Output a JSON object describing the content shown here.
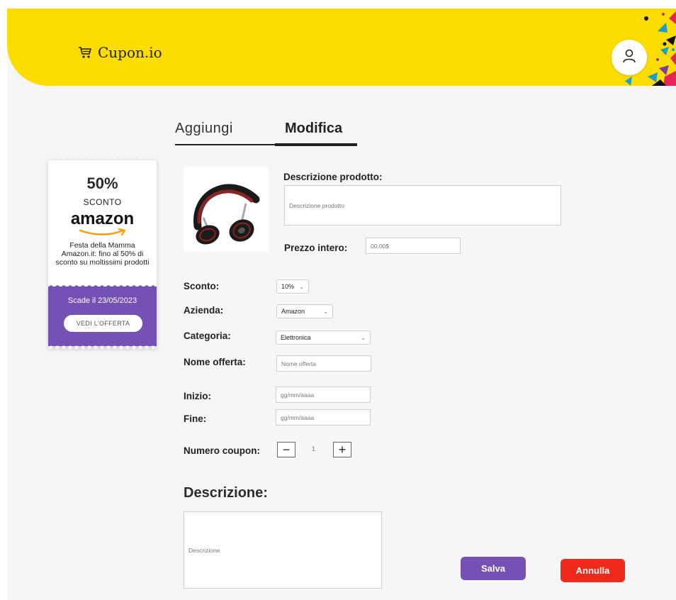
{
  "header": {
    "brand": "Cupon.io",
    "colors": {
      "header_bg": "#fddc00",
      "accent_purple": "#7651b5",
      "cancel_red": "#ef2a1b"
    },
    "icons": {
      "logo": "cart-icon",
      "avatar": "user-icon"
    }
  },
  "tabs": [
    {
      "label": "Aggiungi",
      "active": false
    },
    {
      "label": "Modifica",
      "active": true
    }
  ],
  "coupon": {
    "percent": "50%",
    "sconto": "SCONTO",
    "brand": "amazon",
    "description": "Festa della Mamma Amazon.it: fino al 50% di sconto su moltissimi prodotti",
    "expiry": "Scade il 23/05/2023",
    "cta": "VEDI L'OFFERTA"
  },
  "form": {
    "product_description_label": "Descrizione prodotto:",
    "product_description_placeholder": "Descrizione prodotto",
    "price_label": "Prezzo intero:",
    "price_placeholder": "00.00$",
    "discount_label": "Sconto:",
    "discount_value": "10%",
    "company_label": "Azienda:",
    "company_value": "Amazon",
    "category_label": "Categoria:",
    "category_value": "Elettronica",
    "offer_name_label": "Nome offerta:",
    "offer_name_placeholder": "Nome offerta",
    "start_label": "Inizio:",
    "start_placeholder": "gg/mm/aaaa",
    "end_label": "Fine:",
    "end_placeholder": "gg/mm/aaaa",
    "coupon_count_label": "Numero coupon:",
    "coupon_count_value": "1",
    "description_title": "Descrizione:",
    "description_placeholder": "Descrizione"
  },
  "actions": {
    "save": "Salva",
    "cancel": "Annulla"
  }
}
